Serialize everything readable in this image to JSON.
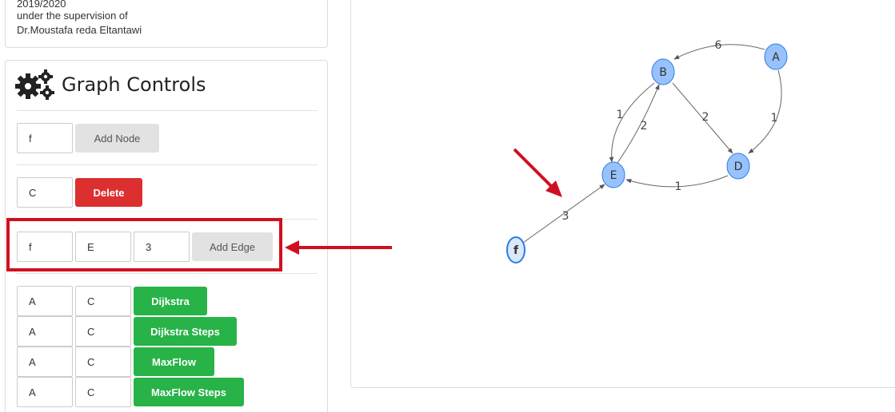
{
  "info": {
    "year": "2019/2020",
    "supervision": "under the supervision of",
    "supervisor": "Dr.Moustafa reda Eltantawi"
  },
  "controls": {
    "title": "Graph Controls",
    "add_node": {
      "value": "f",
      "button": "Add Node"
    },
    "delete": {
      "value": "C",
      "button": "Delete"
    },
    "add_edge": {
      "from": "f",
      "to": "E",
      "weight": "3",
      "button": "Add Edge"
    },
    "algorithms": [
      {
        "from": "A",
        "to": "C",
        "button": "Dijkstra"
      },
      {
        "from": "A",
        "to": "C",
        "button": "Dijkstra Steps"
      },
      {
        "from": "A",
        "to": "C",
        "button": "MaxFlow"
      },
      {
        "from": "A",
        "to": "C",
        "button": "MaxFlow Steps"
      }
    ]
  },
  "graph": {
    "nodes": [
      {
        "id": "A",
        "label": "A"
      },
      {
        "id": "B",
        "label": "B"
      },
      {
        "id": "D",
        "label": "D"
      },
      {
        "id": "E",
        "label": "E"
      },
      {
        "id": "f",
        "label": "f"
      }
    ],
    "edges": [
      {
        "from": "A",
        "to": "B",
        "weight": "6"
      },
      {
        "from": "A",
        "to": "D",
        "weight": "1"
      },
      {
        "from": "B",
        "to": "D",
        "weight": "2"
      },
      {
        "from": "B",
        "to": "E",
        "weight": "1"
      },
      {
        "from": "E",
        "to": "B",
        "weight": "2"
      },
      {
        "from": "D",
        "to": "E",
        "weight": "1"
      },
      {
        "from": "f",
        "to": "E",
        "weight": "3"
      }
    ]
  },
  "colors": {
    "node_fill": "#97c2fc",
    "node_stroke": "#2b7ce9",
    "delete_red": "#dc2f2f",
    "algo_green": "#27b348",
    "annotation_red": "#d0101f"
  }
}
